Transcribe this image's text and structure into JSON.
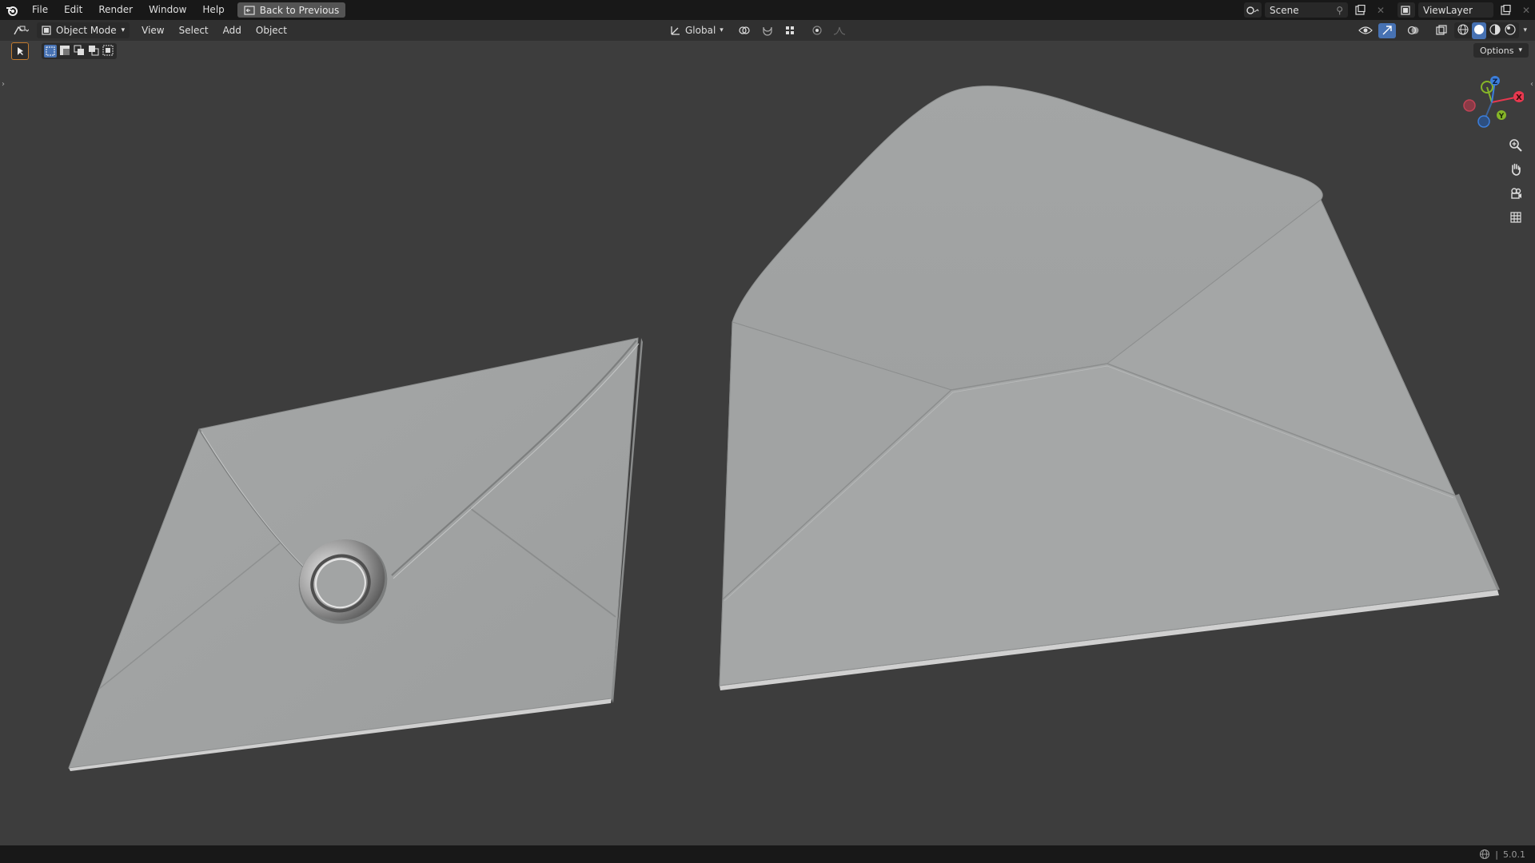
{
  "topbar": {
    "menus": [
      "File",
      "Edit",
      "Render",
      "Window",
      "Help"
    ],
    "back_button": "Back to Previous",
    "scene_name": "Scene",
    "view_layer_name": "ViewLayer"
  },
  "viewport_header": {
    "mode": "Object Mode",
    "menus": [
      "View",
      "Select",
      "Add",
      "Object"
    ],
    "transform_orientation": "Global"
  },
  "tool_header": {
    "options_label": "Options"
  },
  "gizmo": {
    "axes": [
      "X",
      "Y",
      "Z"
    ],
    "colors": {
      "x": "#e8384f",
      "y": "#86b628",
      "z": "#3c7fdc"
    }
  },
  "icons": {
    "nav": [
      "zoom-icon",
      "hand-icon",
      "camera-icon",
      "grid-icon"
    ]
  },
  "statusbar": {
    "version": "5.0.1"
  }
}
